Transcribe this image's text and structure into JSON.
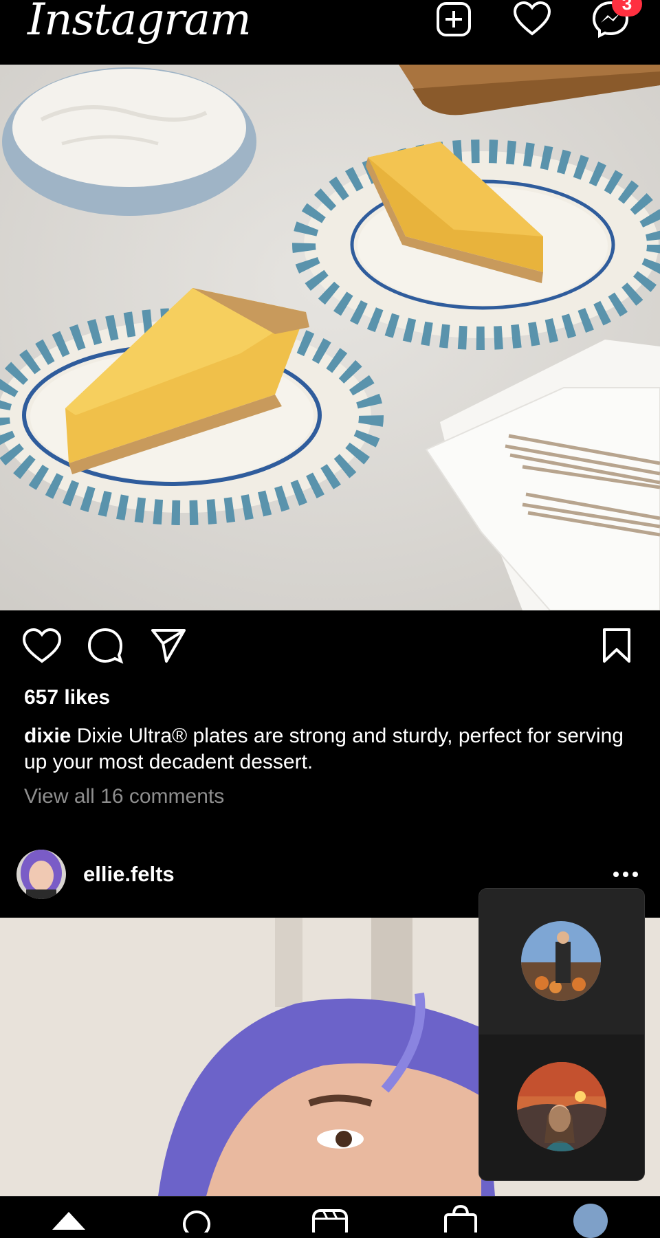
{
  "header": {
    "logo": "Instagram",
    "messages_badge": "3",
    "icons": [
      "new-post-icon",
      "heart-icon",
      "messenger-icon"
    ]
  },
  "post1": {
    "likes": "657 likes",
    "caption_user": "dixie",
    "caption_text": "Dixie Ultra® plates are strong and sturdy, perfect for serving up your most decadent dessert.",
    "view_comments": "View all 16 comments",
    "actions": [
      "like-icon",
      "comment-icon",
      "share-icon",
      "save-icon"
    ]
  },
  "post2": {
    "username": "ellie.felts"
  },
  "call_overlay": {
    "participants": [
      "participant-1",
      "participant-2"
    ]
  },
  "bottom_nav": {
    "items": [
      "home-icon",
      "search-icon",
      "reels-icon",
      "shop-icon",
      "profile-icon"
    ]
  },
  "colors": {
    "background": "#000000",
    "badge": "#ff3040",
    "muted": "#8e8e8e"
  }
}
